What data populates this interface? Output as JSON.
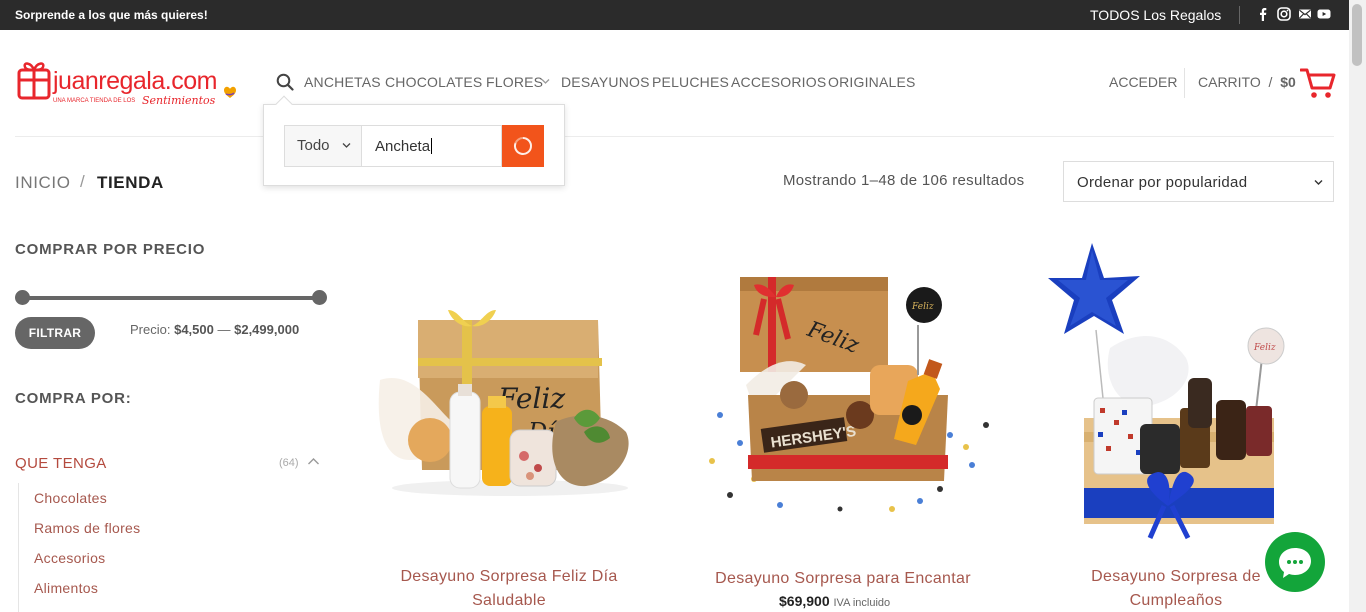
{
  "topbar": {
    "promo": "Sorprende a los que más quieres!",
    "all_gifts": "TODOS Los Regalos",
    "social_icons": [
      "facebook-icon",
      "instagram-icon",
      "email-icon",
      "youtube-icon"
    ]
  },
  "header": {
    "logo_text": "juanregala.com",
    "logo_tagline": "UNA MARCA TIENDA DE LOS Sentimientos",
    "nav": [
      "ANCHETAS",
      "CHOCOLATES",
      "FLORES",
      "DESAYUNOS",
      "PELUCHES",
      "ACCESORIOS",
      "ORIGINALES"
    ],
    "login": "ACCEDER",
    "cart_label": "CARRITO",
    "cart_sep": "/",
    "cart_total": "$0"
  },
  "search": {
    "category": "Todo",
    "query": "Ancheta"
  },
  "breadcrumb": {
    "home": "INICIO",
    "divider": "/",
    "current": "TIENDA"
  },
  "results_text": "Mostrando 1–48 de 106 resultados",
  "sort_label": "Ordenar por popularidad",
  "sidebar": {
    "price_title": "COMPRAR POR PRECIO",
    "filter_button": "FILTRAR",
    "price_label": "Precio:",
    "price_min": "$4,500",
    "price_dash": "—",
    "price_max": "$2,499,000",
    "shop_by_title": "COMPRA POR:",
    "category": "QUE TENGA",
    "category_count": "(64)",
    "subcategories": [
      "Chocolates",
      "Ramos de flores",
      "Accesorios",
      "Alimentos"
    ]
  },
  "products": [
    {
      "title_line1": "Desayuno Sorpresa Feliz Día",
      "title_line2": "Saludable",
      "price": ""
    },
    {
      "title_line1": "Desayuno Sorpresa para Encantar",
      "title_line2": "",
      "price": "$69,900",
      "tax": "IVA incluido"
    },
    {
      "title_line1": "Desayuno Sorpresa de",
      "title_line2": "Cumpleaños",
      "price": ""
    }
  ],
  "colors": {
    "accent": "#f2541b",
    "brand_red": "#e8262c",
    "link": "#a6584e",
    "chat": "#13a53a"
  }
}
